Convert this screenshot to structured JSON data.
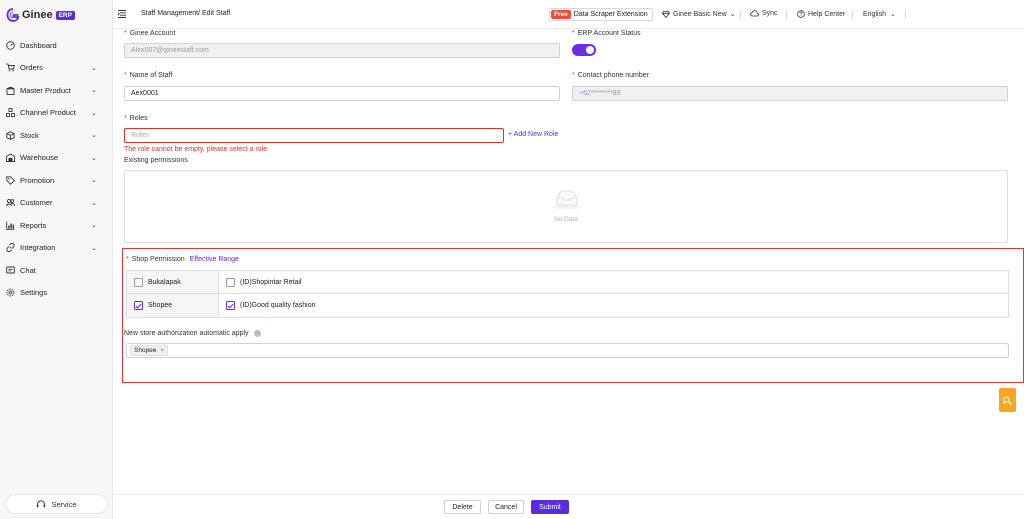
{
  "app": {
    "name": "Ginee",
    "badge": "ERP"
  },
  "sidebar": {
    "items": [
      {
        "label": "Dashboard",
        "icon": "dashboard-icon",
        "chevron": false
      },
      {
        "label": "Orders",
        "icon": "cart-icon",
        "chevron": true
      },
      {
        "label": "Master Product",
        "icon": "bag-icon",
        "chevron": true
      },
      {
        "label": "Channel Product",
        "icon": "channel-icon",
        "chevron": true
      },
      {
        "label": "Stock",
        "icon": "box-icon",
        "chevron": true
      },
      {
        "label": "Warehouse",
        "icon": "warehouse-icon",
        "chevron": true
      },
      {
        "label": "Promotion",
        "icon": "tag-icon",
        "chevron": true
      },
      {
        "label": "Customer",
        "icon": "users-icon",
        "chevron": true
      },
      {
        "label": "Reports",
        "icon": "chart-icon",
        "chevron": true
      },
      {
        "label": "Integration",
        "icon": "link-icon",
        "chevron": true
      },
      {
        "label": "Chat",
        "icon": "chat-icon",
        "chevron": false
      },
      {
        "label": "Settings",
        "icon": "gear-icon",
        "chevron": false
      }
    ],
    "service_label": "Service"
  },
  "topbar": {
    "breadcrumb": "Staff Management/ Edit Staff",
    "promo_free": "Free",
    "promo_text": "Data Scraper Extension",
    "plan": "Ginee Basic New",
    "sync": "Sync",
    "help": "Help Center",
    "language": "English"
  },
  "form": {
    "ginee_account_label": "Ginee Account",
    "ginee_account_value": "Alex007@gineestaff.com",
    "erp_status_label": "ERP Account Status",
    "erp_status_on": true,
    "name_label": "Name of Staff",
    "name_value": "Aex0001",
    "phone_label": "Contact phone number",
    "phone_value": "+62********89",
    "roles_label": "Roles",
    "roles_placeholder": "Roles",
    "add_role": "+ Add New Role",
    "roles_error": "The role cannot be empty, please select a role",
    "existing_permissions_label": "Existing permissions",
    "no_data": "No Data"
  },
  "shop": {
    "label": "Shop Permission",
    "effective_range": "Effective Range",
    "rows": [
      {
        "channel": "Bukalapak",
        "channel_checked": false,
        "store": "(ID)Shopintar Retail",
        "store_checked": false
      },
      {
        "channel": "Shopee",
        "channel_checked": true,
        "store": "(ID)Good quality fashion",
        "store_checked": true
      }
    ],
    "auto_apply_label": "New store authorization automatic apply",
    "auto_apply_tags": [
      "Shopee"
    ]
  },
  "footer": {
    "delete": "Delete",
    "cancel": "Cancel",
    "submit": "Submit"
  },
  "colors": {
    "accent": "#5b2be0",
    "error": "#e0302a",
    "highlight_box": "#e53434",
    "float_button": "#f5a623"
  }
}
